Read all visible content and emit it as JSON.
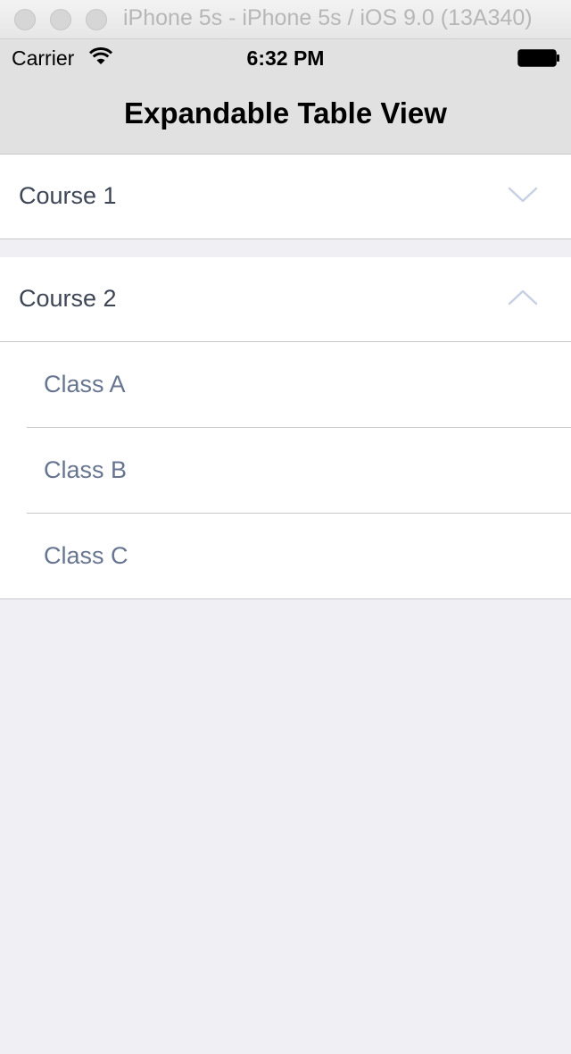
{
  "window": {
    "title": "iPhone 5s - iPhone 5s / iOS 9.0 (13A340)"
  },
  "status_bar": {
    "carrier": "Carrier",
    "time": "6:32 PM"
  },
  "nav": {
    "title": "Expandable Table View"
  },
  "courses": [
    {
      "label": "Course 1",
      "expanded": false,
      "classes": []
    },
    {
      "label": "Course 2",
      "expanded": true,
      "classes": [
        "Class A",
        "Class B",
        "Class C"
      ]
    }
  ],
  "colors": {
    "background": "#efeff4",
    "course_text": "#3e4656",
    "class_text": "#677590",
    "chevron": "#c7d1e3"
  }
}
